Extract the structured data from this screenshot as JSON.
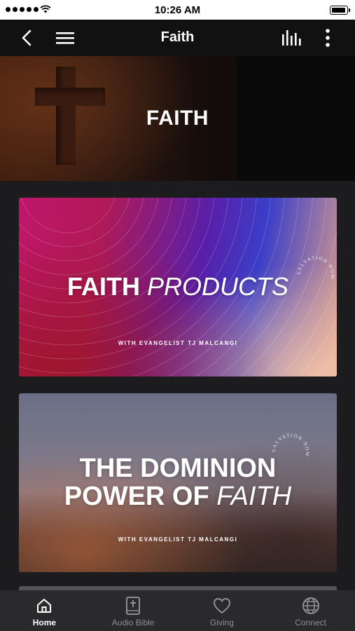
{
  "status_bar": {
    "time": "10:26 AM"
  },
  "header": {
    "title": "Faith"
  },
  "hero": {
    "title": "FAITH"
  },
  "cards": [
    {
      "title_main": "FAITH",
      "title_italic": "PRODUCTS",
      "subtitle": "WITH EVANGELIST TJ MALCANGI",
      "seal_text": "SALVATION NOW"
    },
    {
      "title_line1": "THE DOMINION",
      "title_line2_main": "POWER OF",
      "title_line2_italic": "FAITH",
      "subtitle": "WITH EVANGELIST TJ MALCANGI",
      "seal_text": "SALVATION NOW"
    }
  ],
  "tabs": [
    {
      "label": "Home",
      "icon": "home-icon",
      "active": true
    },
    {
      "label": "Audio Bible",
      "icon": "bible-icon",
      "active": false
    },
    {
      "label": "Giving",
      "icon": "heart-icon",
      "active": false
    },
    {
      "label": "Connect",
      "icon": "globe-icon",
      "active": false
    }
  ],
  "colors": {
    "nav_background": "#111111",
    "tab_bar_background": "#2a2a2d",
    "page_background": "#1c1c1e",
    "active_tab": "#ffffff",
    "inactive_tab": "#8e8e93"
  }
}
